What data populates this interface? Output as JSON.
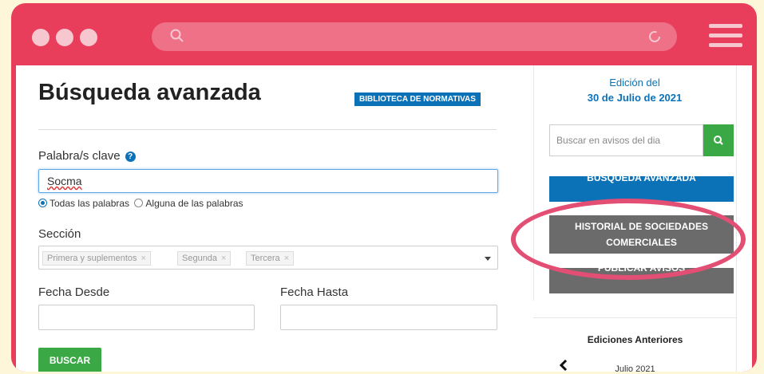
{
  "colors": {
    "frame": "#e83e5c",
    "accent": "#0c72b8",
    "green": "#3aa845",
    "grey_button": "#6b6b6b",
    "highlight": "#e24e74"
  },
  "browser": {
    "url_icon": "search-icon",
    "reload_icon": "reload-icon",
    "menu_icon": "hamburger-menu-icon"
  },
  "main": {
    "title": "Búsqueda avanzada",
    "badge": "BIBLIOTECA DE NORMATIVAS",
    "keyword": {
      "label": "Palabra/s clave",
      "value": "Socma",
      "help_icon": "?"
    },
    "match_mode": {
      "options": [
        "Todas las palabras",
        "Alguna de las palabras"
      ],
      "selected": "Todas las palabras"
    },
    "section": {
      "label": "Sección",
      "tags": [
        "Primera y suplementos",
        "Segunda",
        "Tercera"
      ],
      "remove_glyph": "×"
    },
    "date_from": {
      "label": "Fecha Desde",
      "value": ""
    },
    "date_to": {
      "label": "Fecha Hasta",
      "value": ""
    },
    "submit": "BUSCAR"
  },
  "sidebar": {
    "edition_label": "Edición del",
    "edition_date": "30 de Julio de 2021",
    "search_placeholder": "Buscar en avisos del dia",
    "buttons": {
      "advanced_search": "BÚSQUEDA AVANZADA",
      "company_history_line1": "HISTORIAL DE SOCIEDADES",
      "company_history_line2": "COMERCIALES",
      "publish_notices": "PUBLICAR AVISOS"
    },
    "previous": {
      "title": "Ediciones Anteriores",
      "month": "Julio 2021"
    }
  }
}
